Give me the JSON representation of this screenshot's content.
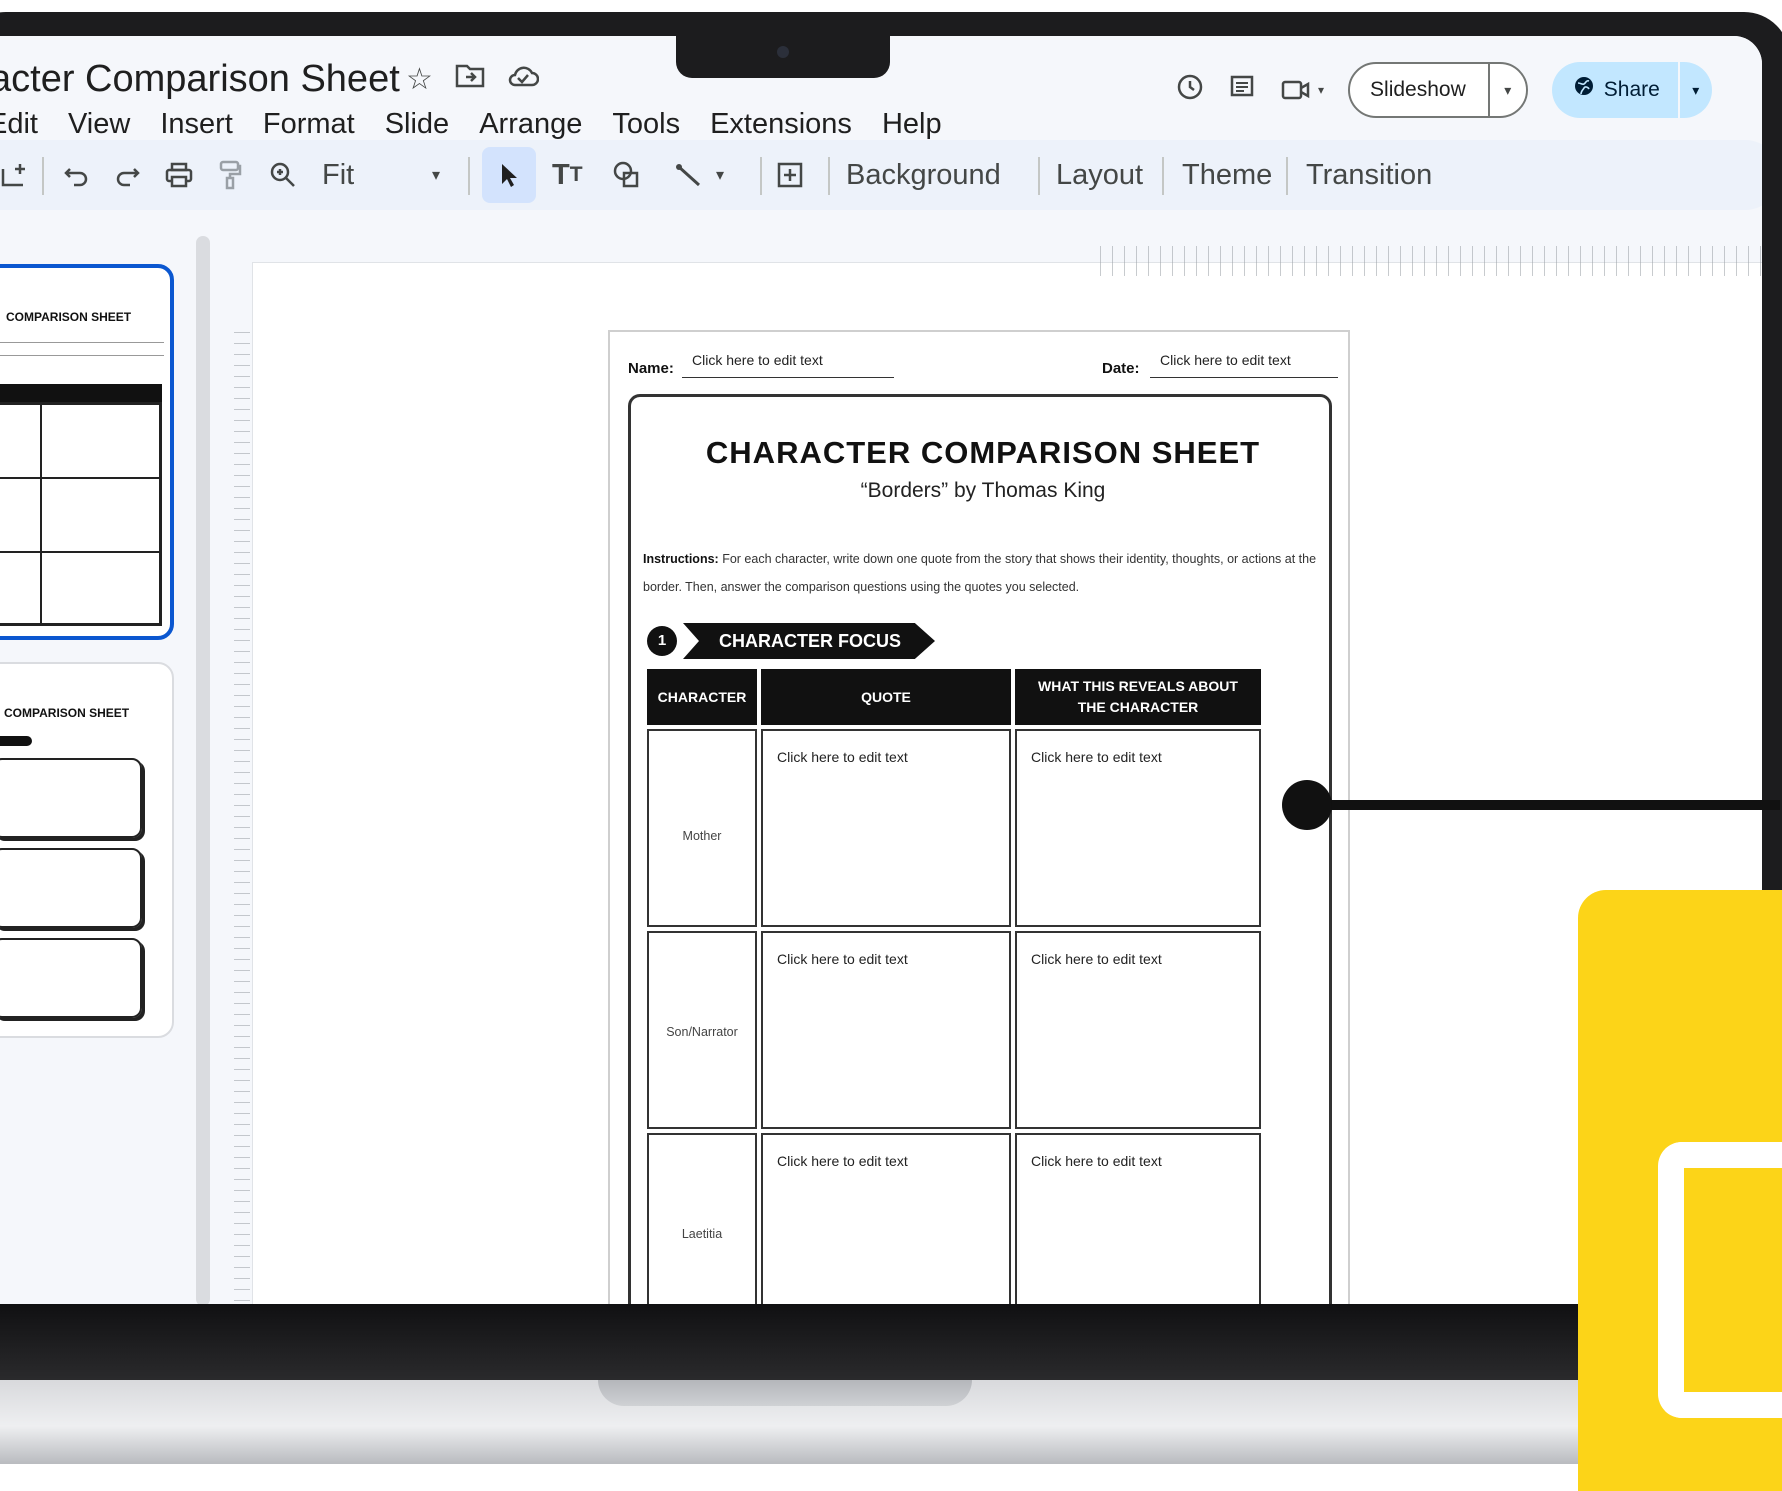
{
  "doc": {
    "title": "acter Comparison Sheet"
  },
  "menu": [
    "Edit",
    "View",
    "Insert",
    "Format",
    "Slide",
    "Arrange",
    "Tools",
    "Extensions",
    "Help"
  ],
  "top_right": {
    "slideshow_label": "Slideshow",
    "share_label": "Share"
  },
  "toolbar": {
    "zoom_label": "Fit",
    "background": "Background",
    "layout": "Layout",
    "theme": "Theme",
    "transition": "Transition"
  },
  "thumbnails": {
    "title": "COMPARISON SHEET"
  },
  "worksheet": {
    "name_label": "Name:",
    "name_value": "Click here to edit text",
    "date_label": "Date:",
    "date_value": "Click here to edit text",
    "title": "CHARACTER COMPARISON SHEET",
    "subtitle": "“Borders” by Thomas King",
    "instructions_label": "Instructions:",
    "instructions_text": "For each character, write down one quote from the story that shows their identity, thoughts, or actions at the border. Then, answer the comparison questions using the quotes you selected.",
    "section_number": "1",
    "section_title": "CHARACTER FOCUS",
    "columns": [
      "CHARACTER",
      "QUOTE",
      "WHAT THIS REVEALS ABOUT THE CHARACTER"
    ],
    "rows": [
      {
        "character": "Mother",
        "quote": "Click here to edit text",
        "reveals": "Click here to edit text"
      },
      {
        "character": "Son/Narrator",
        "quote": "Click here to edit text",
        "reveals": "Click here to edit text"
      },
      {
        "character": "Laetitia",
        "quote": "Click here to edit text",
        "reveals": "Click here to edit text"
      }
    ]
  },
  "colors": {
    "accent_blue": "#0b57d0",
    "share_bg": "#c2e7ff",
    "toolbar_bg": "#edf2fa",
    "slides_yellow": "#fcd418"
  },
  "icons": [
    "star-icon",
    "move-to-folder-icon",
    "cloud-status-icon",
    "history-icon",
    "comments-icon",
    "meet-icon",
    "globe-icon",
    "new-slide-icon",
    "undo-icon",
    "redo-icon",
    "print-icon",
    "paint-format-icon",
    "zoom-icon",
    "select-icon",
    "text-box-icon",
    "shape-icon",
    "line-icon",
    "comment-add-icon"
  ]
}
